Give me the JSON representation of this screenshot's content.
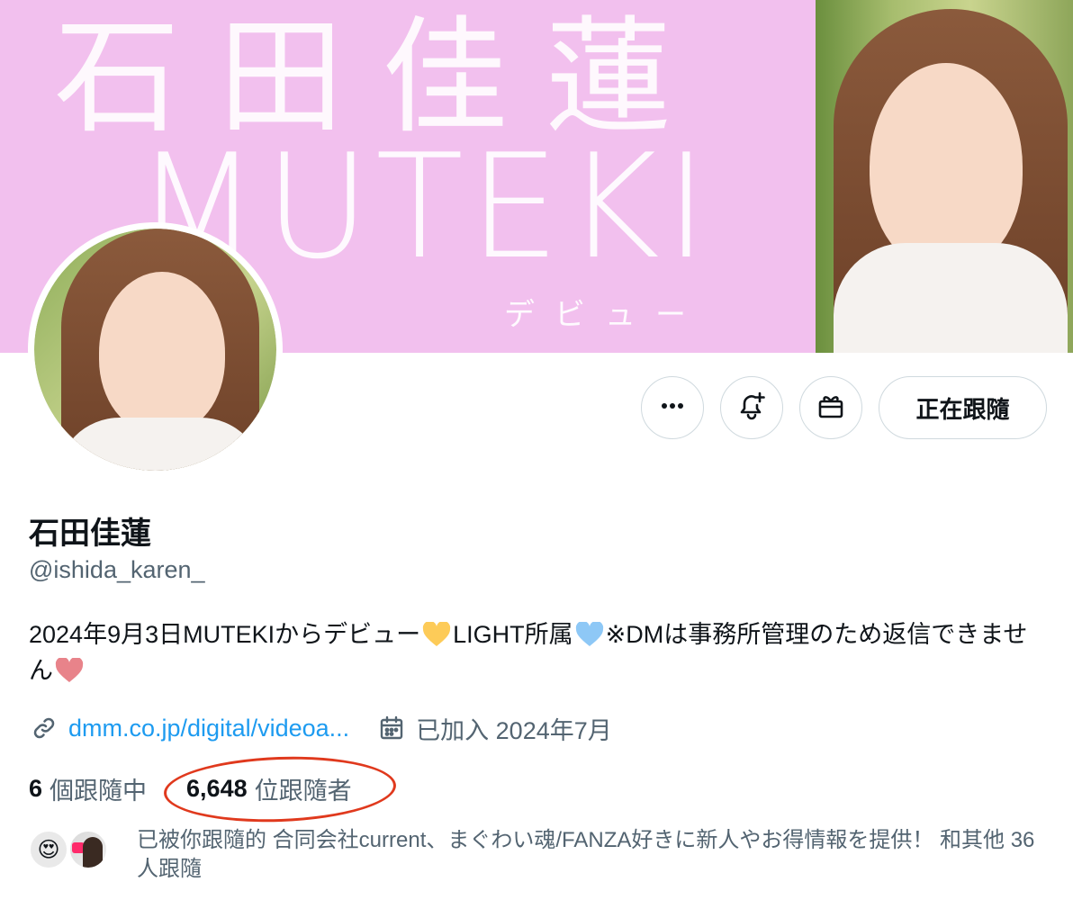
{
  "banner": {
    "title": "石田佳蓮",
    "brand": "MUTEKI",
    "subtitle": "デビュー"
  },
  "actions": {
    "more_icon": "more-horizontal-icon",
    "notify_icon": "bell-plus-icon",
    "gift_icon": "gift-icon",
    "follow_label": "正在跟隨"
  },
  "profile": {
    "display_name": "石田佳蓮",
    "handle": "@ishida_karen_",
    "bio_part1": "2024年9月3日MUTEKIからデビュー",
    "bio_part2": "LIGHT所属",
    "bio_part3": "※DMは事務所管理のため返信できません",
    "link_text": "dmm.co.jp/digital/videoa...",
    "joined": "已加入 2024年7月"
  },
  "stats": {
    "following_count": "6",
    "following_label": "個跟隨中",
    "followers_count": "6,648",
    "followers_label": "位跟隨者"
  },
  "followed_by": {
    "text": "已被你跟隨的 合同会社current、まぐわい魂/FANZA好きに新人やお得情報を提供！ 和其他 36 人跟隨"
  },
  "colors": {
    "banner_pink": "#f2c0ee",
    "link_blue": "#1d9bf0",
    "annotation_red": "#e0391d",
    "secondary_text": "#536471"
  }
}
